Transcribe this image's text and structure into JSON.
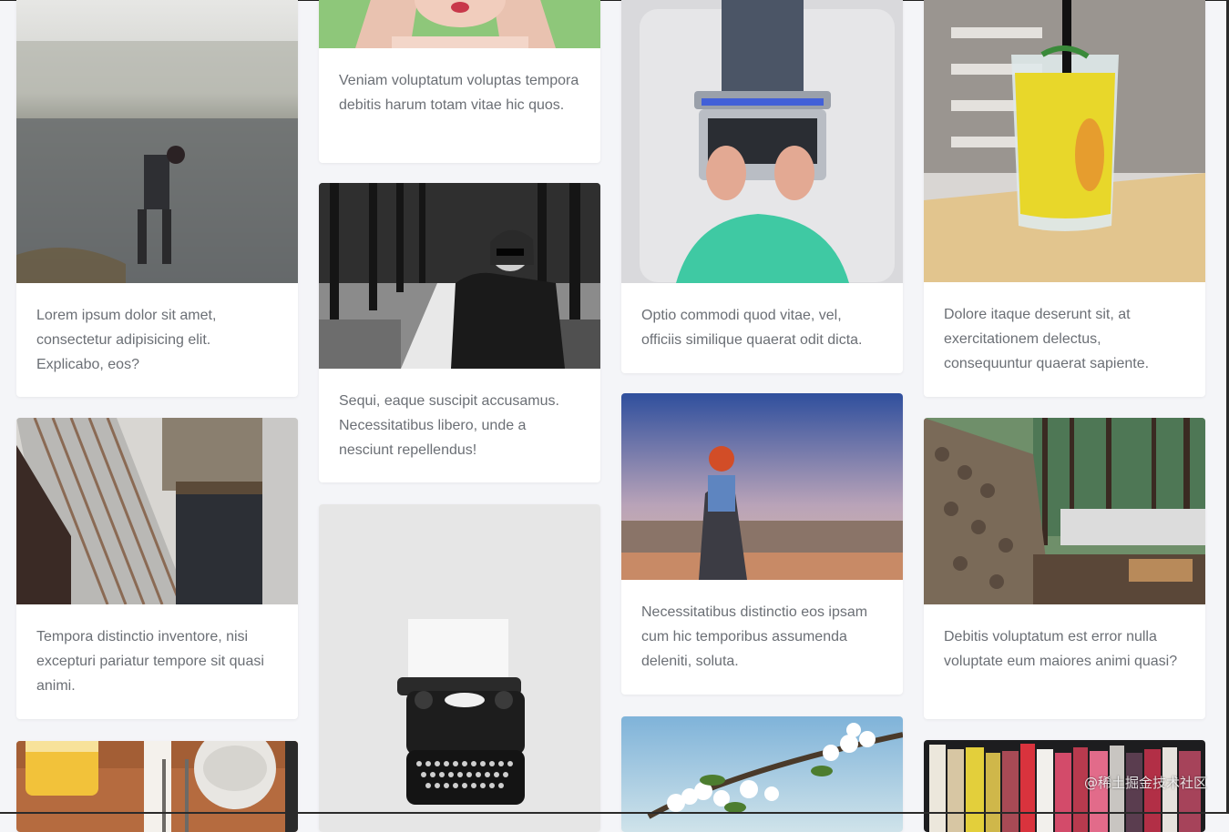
{
  "cards": {
    "c1": {
      "text": "Lorem ipsum dolor sit amet, consectetur adipisicing elit. Explicabo, eos?",
      "photo": "woman-by-lake-photo"
    },
    "c2": {
      "text": "Tempora distinctio inventore, nisi excepturi pariatur tempore sit quasi animi.",
      "photo": "carpenter-photo"
    },
    "c3": {
      "text": "",
      "photo": "breakfast-table-photo"
    },
    "c4": {
      "text": "Veniam voluptatum voluptas tempora debitis harum totam vitae hic quos.",
      "photo": "woman-portrait-photo"
    },
    "c5": {
      "text": "Sequi, eaque suscipit accusamus. Necessitatibus libero, unde a nesciunt repellendus!",
      "photo": "woman-in-park-photo"
    },
    "c6": {
      "text": "",
      "photo": "typewriter-photo"
    },
    "c7": {
      "text": "Optio commodi quod vitae, vel, officiis similique quaerat odit dicta.",
      "photo": "laptop-typing-photo"
    },
    "c8": {
      "text": "Necessitatibus distinctio eos ipsam cum hic temporibus assumenda deleniti, soluta.",
      "photo": "hiker-viewpoint-photo"
    },
    "c9": {
      "text": "",
      "photo": "blossom-branch-photo"
    },
    "c10": {
      "text": "Dolore itaque deserunt sit, at exercitationem delectus, consequuntur quaerat sapiente.",
      "photo": "lemonade-glass-photo"
    },
    "c11": {
      "text": "Debitis voluptatum est error nulla voluptate eum maiores animi quasi?",
      "photo": "woodpile-forest-photo"
    },
    "c12": {
      "text": "",
      "photo": "bookshelf-photo"
    }
  },
  "watermark": "@稀土掘金技术社区",
  "colors": {
    "page_bg": "#f4f5f8",
    "card_bg": "#ffffff",
    "text": "#6b6f75"
  }
}
